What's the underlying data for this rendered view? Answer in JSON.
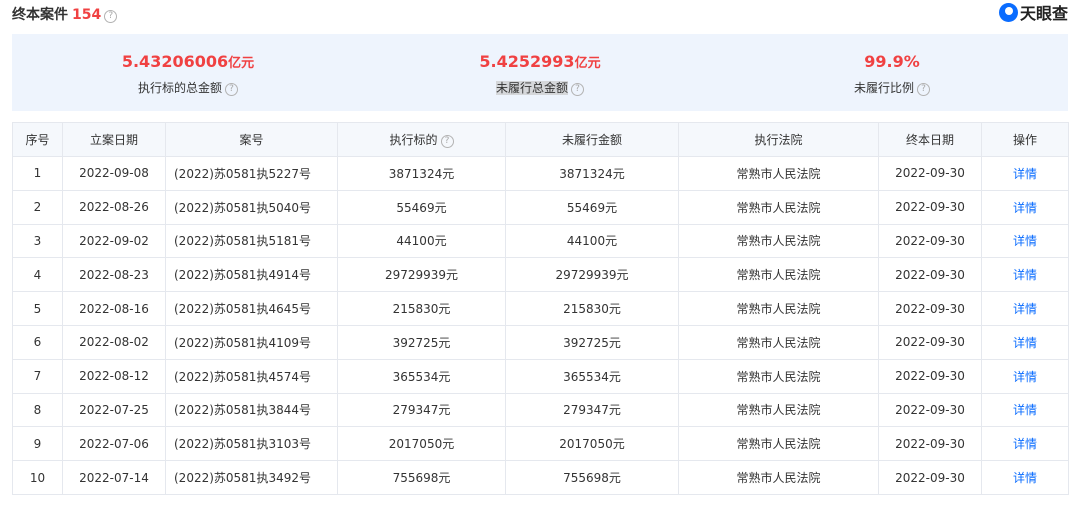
{
  "header": {
    "title": "终本案件",
    "count": "154",
    "help_icon": "question-circle-icon",
    "brand": "天眼查",
    "brand_color": "#0a6cff"
  },
  "summary": {
    "items": [
      {
        "value": "5.43206006",
        "unit": "亿元",
        "label": "执行标的总金额"
      },
      {
        "value": "5.4252993",
        "unit": "亿元",
        "label": "未履行总金额"
      },
      {
        "value": "99.9%",
        "unit": "",
        "label": "未履行比例"
      }
    ],
    "accent_color": "#f04142",
    "background": "#eef4fd"
  },
  "table": {
    "columns": [
      "序号",
      "立案日期",
      "案号",
      "执行标的",
      "未履行金额",
      "执行法院",
      "终本日期",
      "操作"
    ],
    "rows": [
      [
        "1",
        "2022-09-08",
        "(2022)苏0581执5227号",
        "3871324元",
        "3871324元",
        "常熟市人民法院",
        "2022-09-30",
        "详情"
      ],
      [
        "2",
        "2022-08-26",
        "(2022)苏0581执5040号",
        "55469元",
        "55469元",
        "常熟市人民法院",
        "2022-09-30",
        "详情"
      ],
      [
        "3",
        "2022-09-02",
        "(2022)苏0581执5181号",
        "44100元",
        "44100元",
        "常熟市人民法院",
        "2022-09-30",
        "详情"
      ],
      [
        "4",
        "2022-08-23",
        "(2022)苏0581执4914号",
        "29729939元",
        "29729939元",
        "常熟市人民法院",
        "2022-09-30",
        "详情"
      ],
      [
        "5",
        "2022-08-16",
        "(2022)苏0581执4645号",
        "215830元",
        "215830元",
        "常熟市人民法院",
        "2022-09-30",
        "详情"
      ],
      [
        "6",
        "2022-08-02",
        "(2022)苏0581执4109号",
        "392725元",
        "392725元",
        "常熟市人民法院",
        "2022-09-30",
        "详情"
      ],
      [
        "7",
        "2022-08-12",
        "(2022)苏0581执4574号",
        "365534元",
        "365534元",
        "常熟市人民法院",
        "2022-09-30",
        "详情"
      ],
      [
        "8",
        "2022-07-25",
        "(2022)苏0581执3844号",
        "279347元",
        "279347元",
        "常熟市人民法院",
        "2022-09-30",
        "详情"
      ],
      [
        "9",
        "2022-07-06",
        "(2022)苏0581执3103号",
        "2017050元",
        "2017050元",
        "常熟市人民法院",
        "2022-09-30",
        "详情"
      ],
      [
        "10",
        "2022-07-14",
        "(2022)苏0581执3492号",
        "755698元",
        "755698元",
        "常熟市人民法院",
        "2022-09-30",
        "详情"
      ]
    ],
    "link_color": "#0a6cff"
  }
}
